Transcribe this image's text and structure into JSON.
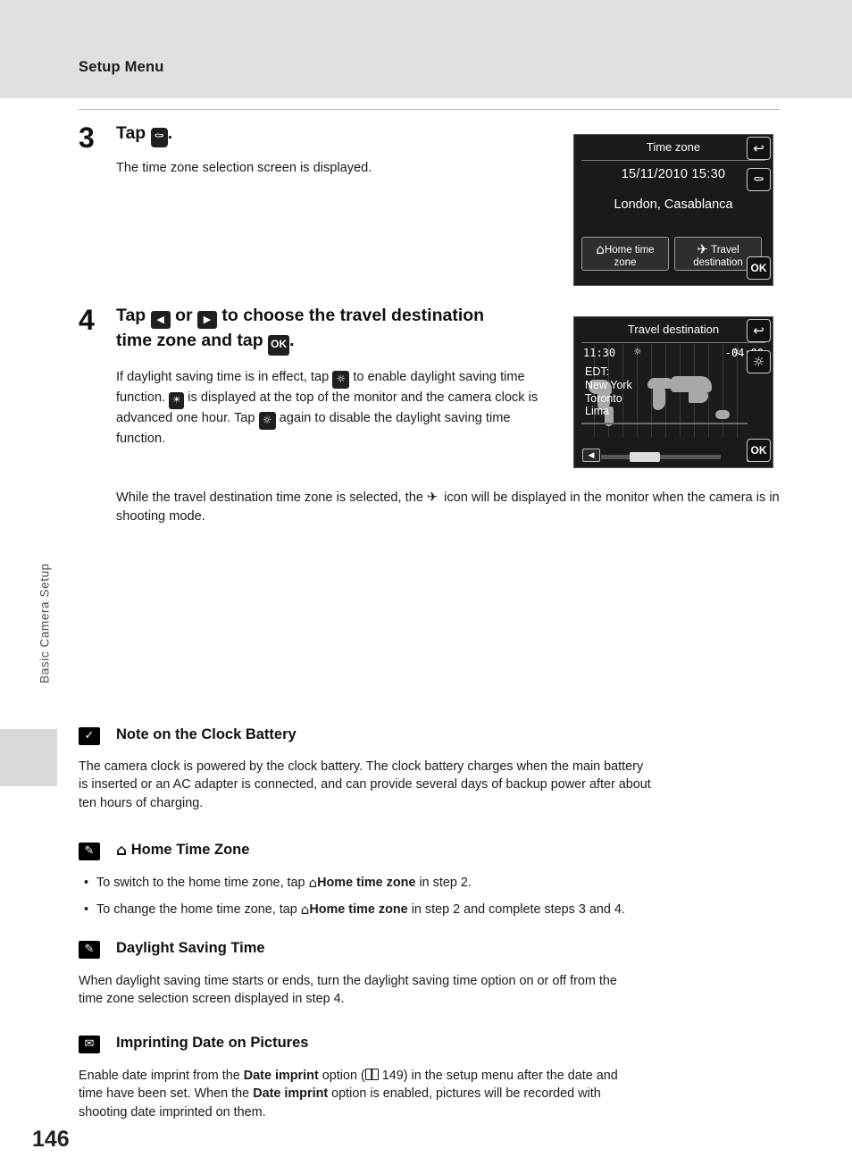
{
  "header": {
    "title": "Setup Menu"
  },
  "side_tab_label": "Basic Camera Setup",
  "page_number": "146",
  "steps": [
    {
      "number": "3",
      "title_pre": "Tap",
      "title_post": ".",
      "icon": "globe-icon",
      "body": "The time zone selection screen is displayed."
    },
    {
      "number": "4",
      "title_line1_a": "Tap",
      "title_line1_b": "or",
      "title_line1_c": "to choose the travel destination",
      "title_line2_a": "time zone and tap",
      "title_line2_b": ".",
      "para1_a": "If daylight saving time is in effect, tap",
      "para1_b": "to enable",
      "para1_c": "daylight saving time function.",
      "para1_d": "is displayed at the top",
      "para1_e": "of the monitor and the camera clock is advanced one",
      "para1_f": "hour. Tap",
      "para1_g": "again to disable the daylight saving time",
      "para1_h": "function.",
      "para2_a": "While the travel destination time zone is selected, the",
      "para2_b": "icon will be displayed in the",
      "para2_c": "monitor when the camera is in shooting mode."
    }
  ],
  "monitor_timezone": {
    "title": "Time zone",
    "datetime": "15/11/2010  15:30",
    "city": "London, Casablanca",
    "button_home_line1": "Home time",
    "button_home_line2": "zone",
    "button_travel_line1": "Travel",
    "button_travel_line2": "destination",
    "back_icon": "back-arrow-icon",
    "globe_icon": "globe-icon",
    "ok_label": "OK"
  },
  "monitor_travel": {
    "title": "Travel destination",
    "time_left": "11:30",
    "time_right": "-04:00",
    "label_edt": "EDT:",
    "cities": [
      "New York",
      "Toronto",
      "Lima"
    ],
    "back_icon": "back-arrow-icon",
    "dst_icon": "daylight-saving-icon",
    "ok_label": "OK",
    "left_arrow": "◀",
    "right_arrow": "▶"
  },
  "notes": [
    {
      "icon": "caution-icon",
      "heading": "Note on the Clock Battery",
      "lines": [
        "The camera clock is powered by the clock battery. The clock battery charges when the main battery",
        "is inserted or an AC adapter is connected, and can provide several days of backup power after about",
        "ten hours of charging."
      ]
    },
    {
      "icon": "pencil-icon",
      "heading_icon": "home-icon",
      "heading": "Home Time Zone",
      "bullets": [
        {
          "a": "To switch to the home time zone, tap",
          "bold": "Home time zone",
          "b": "in step 2."
        },
        {
          "a": "To change the home time zone, tap",
          "bold": "Home time zone",
          "b": "in step 2 and complete steps 3 and 4."
        }
      ]
    },
    {
      "icon": "pencil-icon",
      "heading": "Daylight Saving Time",
      "lines": [
        "When daylight saving time starts or ends, turn the daylight saving time option on or off from the",
        "time zone selection screen displayed in step 4."
      ]
    },
    {
      "icon": "date-imprint-icon",
      "heading": "Imprinting Date on Pictures",
      "line1_a": "Enable date imprint from the",
      "line1_bold": "Date imprint",
      "line1_b": "option (",
      "line1_ref": "149) in the setup menu after the date and",
      "line2_a": "time have been set. When the",
      "line2_bold": "Date imprint",
      "line2_b": "option is enabled, pictures will be recorded with",
      "line3": "shooting date imprinted on them."
    }
  ]
}
